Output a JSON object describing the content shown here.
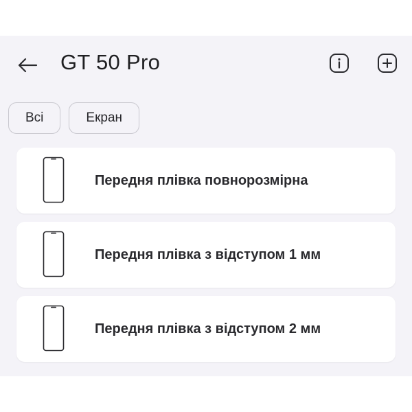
{
  "header": {
    "title": "GT 50 Pro",
    "back_icon": "arrow-left-icon",
    "info_icon": "info-icon",
    "add_icon": "plus-square-icon"
  },
  "filters": [
    {
      "label": "Всі"
    },
    {
      "label": "Екран"
    }
  ],
  "items": [
    {
      "label": "Передня плівка повнорозмірна",
      "icon": "phone-outline-icon"
    },
    {
      "label": "Передня плівка з відступом 1 мм",
      "icon": "phone-outline-icon"
    },
    {
      "label": "Передня плівка з відступом 2 мм",
      "icon": "phone-outline-icon"
    }
  ],
  "colors": {
    "background": "#f4f3f8",
    "card": "#ffffff",
    "text": "#2a2a2e",
    "chip_border": "#c9c8cf"
  }
}
